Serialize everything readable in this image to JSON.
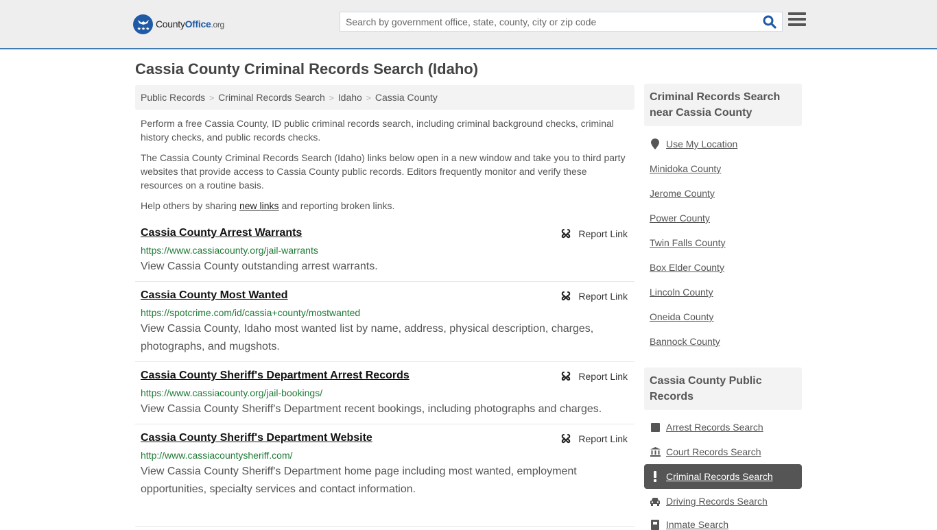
{
  "header": {
    "logo": {
      "part1": "County",
      "part2": "Office",
      "part3": ".org"
    },
    "search": {
      "placeholder": "Search by government office, state, county, city or zip code",
      "value": ""
    },
    "colors": {
      "brand": "#1f5aa6",
      "accent_border": "#3e7cb1",
      "url_green": "#1e7a34"
    }
  },
  "page": {
    "title": "Cassia County Criminal Records Search (Idaho)",
    "breadcrumb": [
      "Public Records",
      "Criminal Records Search",
      "Idaho",
      "Cassia County"
    ],
    "intro1": "Perform a free Cassia County, ID public criminal records search, including criminal background checks, criminal history checks, and public records checks.",
    "intro2": "The Cassia County Criminal Records Search (Idaho) links below open in a new window and take you to third party websites that provide access to Cassia County public records. Editors frequently monitor and verify these resources on a routine basis.",
    "intro3_pre": "Help others by sharing ",
    "intro3_link": "new links",
    "intro3_post": " and reporting broken links."
  },
  "entries": [
    {
      "title": "Cassia County Arrest Warrants",
      "url": "https://www.cassiacounty.org/jail-warrants",
      "desc": "View Cassia County outstanding arrest warrants.",
      "report": "Report Link"
    },
    {
      "title": "Cassia County Most Wanted",
      "url": "https://spotcrime.com/id/cassia+county/mostwanted",
      "desc": "View Cassia County, Idaho most wanted list by name, address, physical description, charges, photographs, and mugshots.",
      "report": "Report Link"
    },
    {
      "title": "Cassia County Sheriff's Department Arrest Records",
      "url": "https://www.cassiacounty.org/jail-bookings/",
      "desc": "View Cassia County Sheriff's Department recent bookings, including photographs and charges.",
      "report": "Report Link"
    },
    {
      "title": "Cassia County Sheriff's Department Website",
      "url": "http://www.cassiacountysheriff.com/",
      "desc": "View Cassia County Sheriff's Department home page including most wanted, employment opportunities, specialty services and contact information.",
      "report": "Report Link"
    }
  ],
  "sidebar": {
    "nearby_heading": "Criminal Records Search near Cassia County",
    "use_location": "Use My Location",
    "nearby": [
      "Minidoka County",
      "Jerome County",
      "Power County",
      "Twin Falls County",
      "Box Elder County",
      "Lincoln County",
      "Oneida County",
      "Bannock County"
    ],
    "records_heading": "Cassia County Public Records",
    "records": [
      {
        "label": "Arrest Records Search",
        "icon": "square-icon",
        "active": false
      },
      {
        "label": "Court Records Search",
        "icon": "courthouse-icon",
        "active": false
      },
      {
        "label": "Criminal Records Search",
        "icon": "exclamation-icon",
        "active": true
      },
      {
        "label": "Driving Records Search",
        "icon": "car-icon",
        "active": false
      },
      {
        "label": "Inmate Search",
        "icon": "inmate-icon",
        "active": false
      }
    ]
  }
}
